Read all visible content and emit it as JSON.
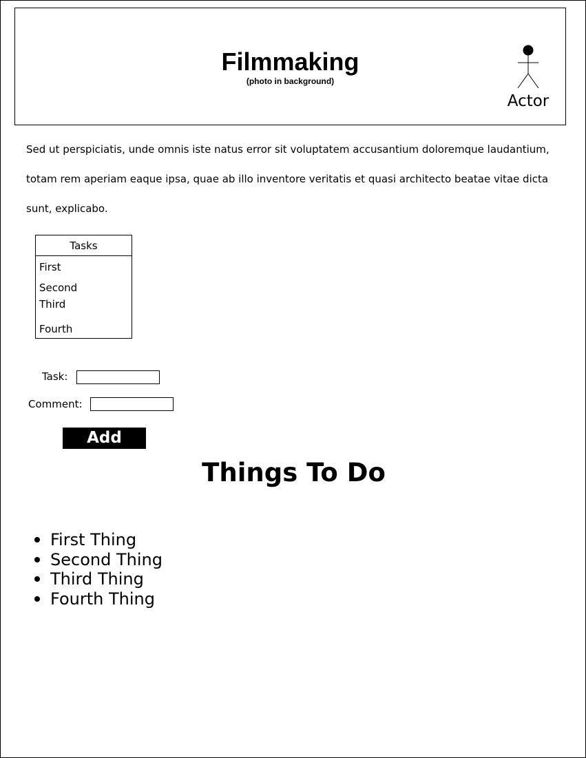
{
  "header": {
    "title": "Filmmaking",
    "subtitle": "(photo in background)",
    "actor_label": "Actor",
    "actor_icon": "stick-figure-actor-icon"
  },
  "intro_text": "Sed ut perspiciatis, unde omnis iste natus error sit voluptatem accusantium doloremque laudantium, totam rem aperiam eaque ipsa, quae ab illo inventore veritatis et quasi architecto beatae vitae dicta sunt, explicabo.",
  "tasks": {
    "heading": "Tasks",
    "items": [
      "First",
      "Second",
      "Third",
      "Fourth"
    ]
  },
  "form": {
    "task_label": "Task:",
    "task_value": "",
    "comment_label": "Comment:",
    "comment_value": "",
    "add_label": "Add"
  },
  "todo": {
    "title": "Things To Do",
    "items": [
      "First Thing",
      "Second Thing",
      "Third Thing",
      "Fourth Thing"
    ]
  }
}
